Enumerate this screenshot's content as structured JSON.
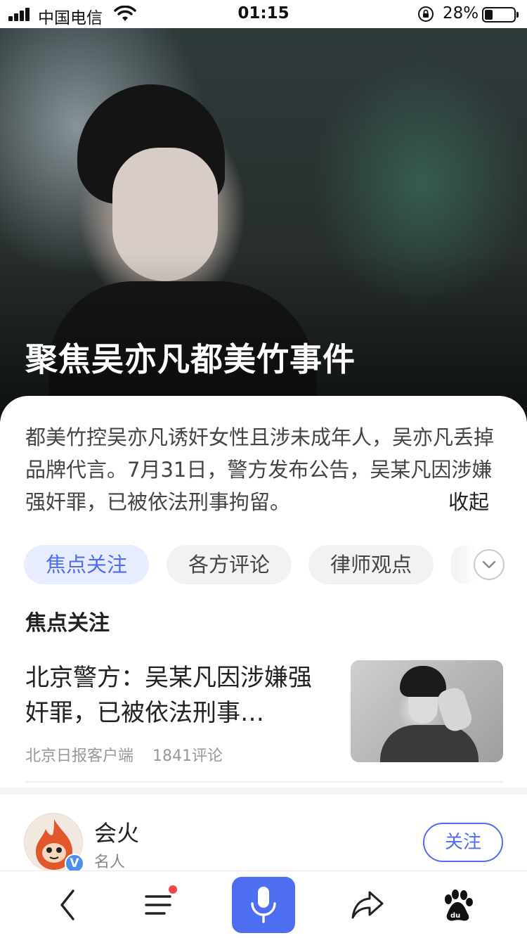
{
  "status_bar": {
    "carrier": "中国电信",
    "time": "01:15",
    "battery_pct": "28%",
    "battery_level": 0.28
  },
  "hero": {
    "title": "聚焦吴亦凡都美竹事件"
  },
  "summary": {
    "text": "都美竹控吴亦凡诱奸女性且涉未成年人，吴亦凡丢掉品牌代言。7月31日，警方发布公告，吴某凡因涉嫌强奸罪，已被依法刑事拘留。",
    "collapse_label": "收起"
  },
  "tabs": [
    {
      "label": "焦点关注",
      "active": true
    },
    {
      "label": "各方评论",
      "active": false
    },
    {
      "label": "律师观点",
      "active": false
    }
  ],
  "section": {
    "title": "焦点关注"
  },
  "news": {
    "title": "北京警方：吴某凡因涉嫌强奸罪，已被依法刑事…",
    "source": "北京日报客户端",
    "comments": "1841评论"
  },
  "author": {
    "name": "会火",
    "subtitle": "名人",
    "follow_label": "关注"
  },
  "icons": {
    "signal": "signal-icon",
    "wifi": "wifi-icon",
    "lock": "rotation-lock-icon",
    "back": "back-icon",
    "menu": "menu-icon",
    "mic": "microphone-icon",
    "share": "share-icon",
    "baidu": "baidu-paw-icon"
  },
  "colors": {
    "accent": "#4e6ef2",
    "notification_dot": "#f24747",
    "verify_badge": "#4e8df2"
  }
}
